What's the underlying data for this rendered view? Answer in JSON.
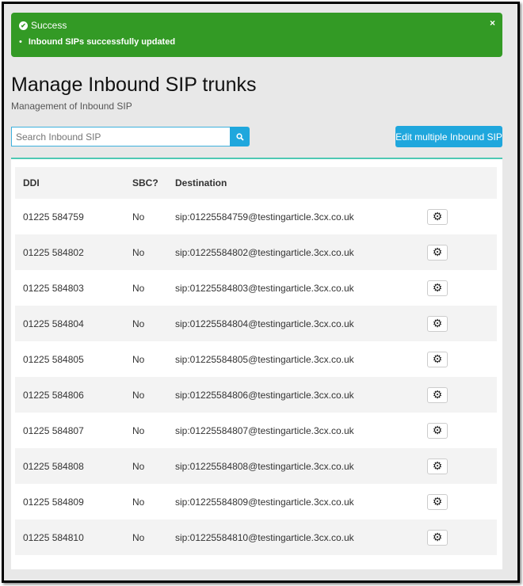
{
  "alert": {
    "title": "Success",
    "messages": [
      "Inbound SIPs successfully updated"
    ],
    "close": "×"
  },
  "page": {
    "title": "Manage Inbound SIP trunks",
    "subtitle": "Management of Inbound SIP"
  },
  "search": {
    "placeholder": "Search Inbound SIP"
  },
  "edit_multiple_label": "Edit multiple Inbound SIP",
  "table": {
    "headers": [
      "DDI",
      "SBC?",
      "Destination"
    ],
    "rows": [
      {
        "ddi": "01225 584759",
        "sbc": "No",
        "dest": "sip:01225584759@testingarticle.3cx.co.uk"
      },
      {
        "ddi": "01225 584802",
        "sbc": "No",
        "dest": "sip:01225584802@testingarticle.3cx.co.uk"
      },
      {
        "ddi": "01225 584803",
        "sbc": "No",
        "dest": "sip:01225584803@testingarticle.3cx.co.uk"
      },
      {
        "ddi": "01225 584804",
        "sbc": "No",
        "dest": "sip:01225584804@testingarticle.3cx.co.uk"
      },
      {
        "ddi": "01225 584805",
        "sbc": "No",
        "dest": "sip:01225584805@testingarticle.3cx.co.uk"
      },
      {
        "ddi": "01225 584806",
        "sbc": "No",
        "dest": "sip:01225584806@testingarticle.3cx.co.uk"
      },
      {
        "ddi": "01225 584807",
        "sbc": "No",
        "dest": "sip:01225584807@testingarticle.3cx.co.uk"
      },
      {
        "ddi": "01225 584808",
        "sbc": "No",
        "dest": "sip:01225584808@testingarticle.3cx.co.uk"
      },
      {
        "ddi": "01225 584809",
        "sbc": "No",
        "dest": "sip:01225584809@testingarticle.3cx.co.uk"
      },
      {
        "ddi": "01225 584810",
        "sbc": "No",
        "dest": "sip:01225584810@testingarticle.3cx.co.uk"
      }
    ]
  }
}
